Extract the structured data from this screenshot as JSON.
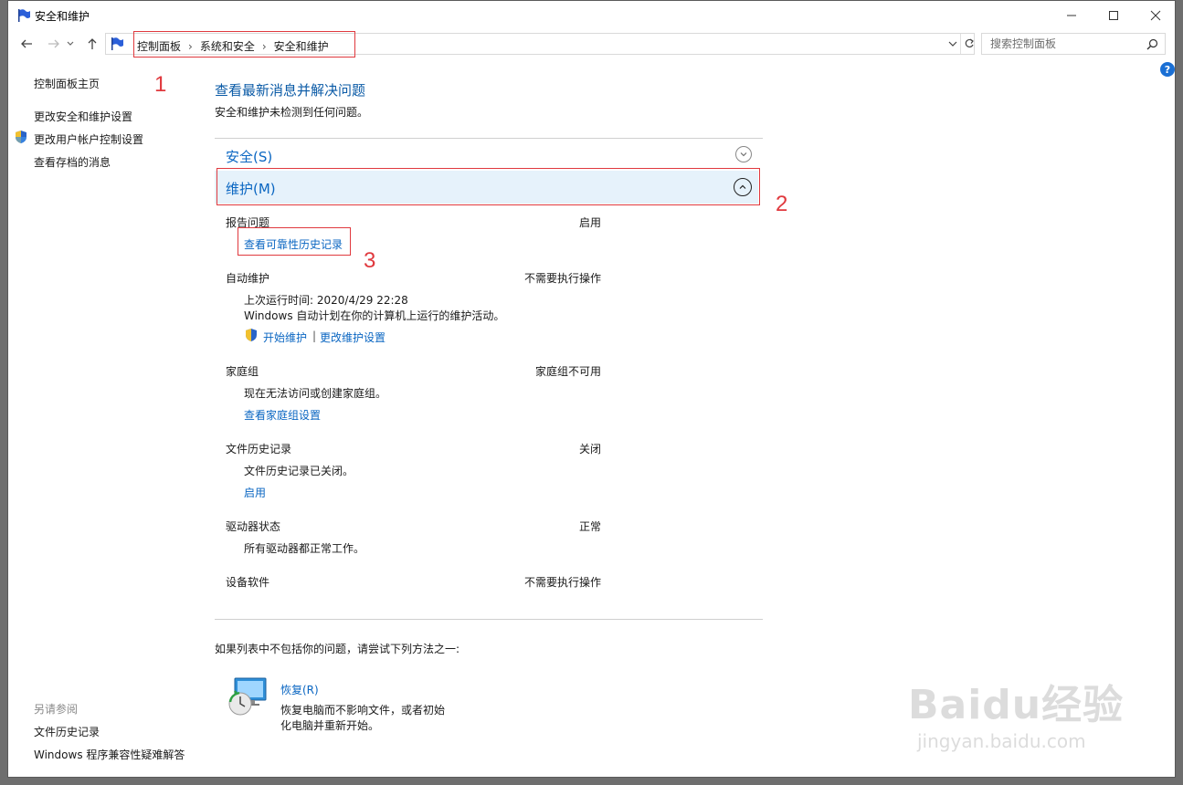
{
  "window": {
    "title": "安全和维护"
  },
  "address_bar": {
    "crumbs": [
      "控制面板",
      "系统和安全",
      "安全和维护"
    ],
    "search_placeholder": "搜索控制面板"
  },
  "sidebar": {
    "home": "控制面板主页",
    "links": [
      "更改安全和维护设置",
      "更改用户帐户控制设置",
      "查看存档的消息"
    ],
    "see_also_heading": "另请参阅",
    "see_also": [
      "文件历史记录",
      "Windows 程序兼容性疑难解答"
    ]
  },
  "main": {
    "heading": "查看最新消息并解决问题",
    "subheading": "安全和维护未检测到任何问题。",
    "security_section": "安全(S)",
    "maintenance_section": "维护(M)",
    "items": {
      "report": {
        "label": "报告问题",
        "status": "启用",
        "link": "查看可靠性历史记录"
      },
      "auto": {
        "label": "自动维护",
        "status": "不需要执行操作",
        "desc1": "上次运行时间: 2020/4/29 22:28",
        "desc2": "Windows 自动计划在你的计算机上运行的维护活动。",
        "link_start": "开始维护",
        "divider": "|",
        "link_change": "更改维护设置"
      },
      "homegroup": {
        "label": "家庭组",
        "status": "家庭组不可用",
        "desc": "现在无法访问或创建家庭组。",
        "link": "查看家庭组设置"
      },
      "filehistory": {
        "label": "文件历史记录",
        "status": "关闭",
        "desc": "文件历史记录已关闭。",
        "link": "启用"
      },
      "drive": {
        "label": "驱动器状态",
        "status": "正常",
        "desc": "所有驱动器都正常工作。"
      },
      "device": {
        "label": "设备软件",
        "status": "不需要执行操作"
      }
    },
    "footer_text": "如果列表中不包括你的问题，请尝试下列方法之一:",
    "recovery": {
      "title": "恢复(R)",
      "desc1": "恢复电脑而不影响文件，或者初始",
      "desc2": "化电脑并重新开始。"
    }
  },
  "annotations": {
    "n1": "1",
    "n2": "2",
    "n3": "3"
  },
  "watermark": {
    "brand": "Baidu经验",
    "url": "jingyan.baidu.com"
  },
  "colors": {
    "link": "#0a66c2",
    "heading": "#0a5aa6",
    "annotation": "#e0393e",
    "section_bg": "#e6f2fb"
  }
}
